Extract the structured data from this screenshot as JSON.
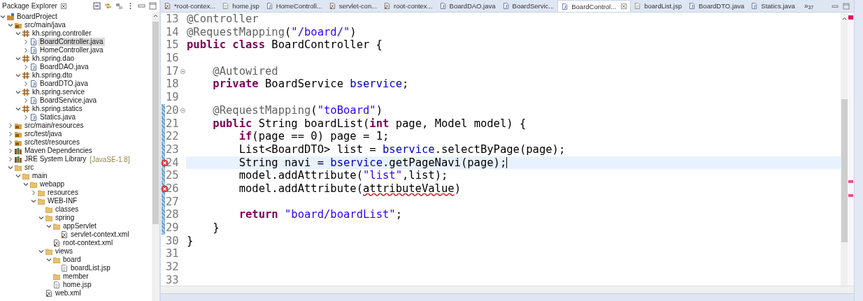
{
  "explorer": {
    "title": "Package Explorer",
    "tree": [
      {
        "label": "BoardProject",
        "kind": "project",
        "expanded": true,
        "selected": false,
        "children": [
          {
            "label": "src/main/java",
            "kind": "source-folder",
            "expanded": true,
            "selected": false,
            "children": [
              {
                "label": "kh.spring.controller",
                "kind": "package",
                "expanded": true,
                "selected": false,
                "children": [
                  {
                    "label": "BoardController.java",
                    "kind": "java",
                    "expanded": false,
                    "selected": true
                  },
                  {
                    "label": "HomeController.java",
                    "kind": "java",
                    "expanded": false,
                    "selected": false
                  }
                ]
              },
              {
                "label": "kh.spring.dao",
                "kind": "package",
                "expanded": true,
                "selected": false,
                "children": [
                  {
                    "label": "BoardDAO.java",
                    "kind": "java",
                    "expanded": false,
                    "selected": false
                  }
                ]
              },
              {
                "label": "kh.spring.dto",
                "kind": "package",
                "expanded": true,
                "selected": false,
                "children": [
                  {
                    "label": "BoardDTO.java",
                    "kind": "java",
                    "expanded": false,
                    "selected": false
                  }
                ]
              },
              {
                "label": "kh.spring.service",
                "kind": "package",
                "expanded": true,
                "selected": false,
                "children": [
                  {
                    "label": "BoardService.java",
                    "kind": "java",
                    "expanded": false,
                    "selected": false
                  }
                ]
              },
              {
                "label": "kh.spring.statics",
                "kind": "package",
                "expanded": true,
                "selected": false,
                "children": [
                  {
                    "label": "Statics.java",
                    "kind": "java",
                    "expanded": false,
                    "selected": false
                  }
                ]
              }
            ]
          },
          {
            "label": "src/main/resources",
            "kind": "source-folder",
            "expanded": false,
            "selected": false
          },
          {
            "label": "src/test/java",
            "kind": "source-folder",
            "expanded": false,
            "selected": false
          },
          {
            "label": "src/test/resources",
            "kind": "source-folder",
            "expanded": false,
            "selected": false
          },
          {
            "label": "Maven Dependencies",
            "kind": "library",
            "expanded": false,
            "selected": false
          },
          {
            "label": "JRE System Library",
            "decoration": "[JavaSE-1.8]",
            "kind": "library",
            "expanded": false,
            "selected": false
          },
          {
            "label": "src",
            "kind": "folder",
            "expanded": true,
            "selected": false,
            "children": [
              {
                "label": "main",
                "kind": "folder",
                "expanded": true,
                "selected": false,
                "children": [
                  {
                    "label": "webapp",
                    "kind": "folder",
                    "expanded": true,
                    "selected": false,
                    "children": [
                      {
                        "label": "resources",
                        "kind": "folder",
                        "expanded": false,
                        "selected": false
                      },
                      {
                        "label": "WEB-INF",
                        "kind": "folder",
                        "expanded": true,
                        "selected": false,
                        "children": [
                          {
                            "label": "classes",
                            "kind": "folder",
                            "selected": false
                          },
                          {
                            "label": "spring",
                            "kind": "folder",
                            "expanded": true,
                            "selected": false,
                            "children": [
                              {
                                "label": "appServlet",
                                "kind": "folder",
                                "expanded": true,
                                "selected": false,
                                "children": [
                                  {
                                    "label": "servlet-context.xml",
                                    "kind": "xml",
                                    "selected": false
                                  }
                                ]
                              },
                              {
                                "label": "root-context.xml",
                                "kind": "xml",
                                "selected": false
                              }
                            ]
                          },
                          {
                            "label": "views",
                            "kind": "folder",
                            "expanded": true,
                            "selected": false,
                            "children": [
                              {
                                "label": "board",
                                "kind": "folder",
                                "expanded": true,
                                "selected": false,
                                "children": [
                                  {
                                    "label": "boardList.jsp",
                                    "kind": "jsp",
                                    "selected": false
                                  }
                                ]
                              },
                              {
                                "label": "member",
                                "kind": "folder",
                                "selected": false
                              },
                              {
                                "label": "home.jsp",
                                "kind": "jsp",
                                "selected": false
                              }
                            ]
                          },
                          {
                            "label": "web.xml",
                            "kind": "xml",
                            "selected": false
                          }
                        ]
                      }
                    ]
                  }
                ]
              }
            ]
          }
        ]
      }
    ]
  },
  "editor": {
    "tabs": [
      {
        "label": "*root-contex...",
        "kind": "xml",
        "selected": false
      },
      {
        "label": "home.jsp",
        "kind": "jsp",
        "selected": false
      },
      {
        "label": "HomeControll...",
        "kind": "java",
        "selected": false
      },
      {
        "label": "servlet-con...",
        "kind": "xml",
        "selected": false
      },
      {
        "label": "root-contex...",
        "kind": "xml",
        "selected": false
      },
      {
        "label": "BoardDAO.java",
        "kind": "java",
        "selected": false
      },
      {
        "label": "BoardServic...",
        "kind": "java",
        "selected": false
      },
      {
        "label": "BoardControl...",
        "kind": "java",
        "selected": true
      },
      {
        "label": "boardList.jsp",
        "kind": "jsp",
        "selected": false
      },
      {
        "label": "BoardDTO.java",
        "kind": "java",
        "selected": false
      },
      {
        "label": "Statics.java",
        "kind": "java",
        "selected": false
      }
    ],
    "overflow": {
      "glyph": "»",
      "count": "37"
    },
    "lines": [
      {
        "number": "13",
        "segments": [
          {
            "text": "@Controller",
            "kind": "annotation"
          }
        ]
      },
      {
        "number": "14",
        "segments": [
          {
            "text": "@RequestMapping",
            "kind": "annotation"
          },
          {
            "text": "(",
            "kind": "plain"
          },
          {
            "text": "\"/board/\"",
            "kind": "string"
          },
          {
            "text": ")",
            "kind": "plain"
          }
        ]
      },
      {
        "number": "15",
        "segments": [
          {
            "text": "public class",
            "kind": "keyword"
          },
          {
            "text": " BoardController {",
            "kind": "plain"
          }
        ]
      },
      {
        "number": "16"
      },
      {
        "number": "17",
        "fold": true,
        "segments": [
          {
            "text": "    @Autowired",
            "kind": "annotation"
          }
        ]
      },
      {
        "number": "18",
        "segments": [
          {
            "text": "    private",
            "kind": "keyword"
          },
          {
            "text": " BoardService ",
            "kind": "plain"
          },
          {
            "text": "bservice",
            "kind": "field"
          },
          {
            "text": ";",
            "kind": "plain"
          }
        ]
      },
      {
        "number": "19"
      },
      {
        "number": "20",
        "fold": true,
        "changed": true,
        "segments": [
          {
            "text": "    @RequestMapping",
            "kind": "annotation"
          },
          {
            "text": "(",
            "kind": "plain"
          },
          {
            "text": "\"toBoard\"",
            "kind": "string"
          },
          {
            "text": ")",
            "kind": "plain"
          }
        ]
      },
      {
        "number": "21",
        "changed": true,
        "segments": [
          {
            "text": "    public",
            "kind": "keyword"
          },
          {
            "text": " String boardList(",
            "kind": "plain"
          },
          {
            "text": "int",
            "kind": "keyword"
          },
          {
            "text": " page, Model model) {",
            "kind": "plain"
          }
        ]
      },
      {
        "number": "22",
        "changed": true,
        "segments": [
          {
            "text": "        if",
            "kind": "keyword"
          },
          {
            "text": "(page == 0) page = 1;",
            "kind": "plain"
          }
        ]
      },
      {
        "number": "23",
        "changed": true,
        "segments": [
          {
            "text": "        List<BoardDTO> list = ",
            "kind": "plain"
          },
          {
            "text": "bservice",
            "kind": "field"
          },
          {
            "text": ".selectByPage(page);",
            "kind": "plain"
          }
        ]
      },
      {
        "number": "24",
        "changed": true,
        "error": true,
        "current": true,
        "segments": [
          {
            "text": "        String navi = ",
            "kind": "plain"
          },
          {
            "text": "bservice",
            "kind": "field"
          },
          {
            "text": ".getPageNavi(page);",
            "kind": "plain"
          }
        ]
      },
      {
        "number": "25",
        "changed": true,
        "segments": [
          {
            "text": "        model.addAttribute(",
            "kind": "plain"
          },
          {
            "text": "\"list\"",
            "kind": "string"
          },
          {
            "text": ",list);",
            "kind": "plain"
          }
        ]
      },
      {
        "number": "26",
        "changed": true,
        "error": true,
        "segments": [
          {
            "text": "        model.addAttribute(",
            "kind": "plain"
          },
          {
            "text": "attributeValue",
            "kind": "error"
          },
          {
            "text": ")",
            "kind": "plain"
          }
        ]
      },
      {
        "number": "27",
        "changed": true
      },
      {
        "number": "28",
        "changed": true,
        "segments": [
          {
            "text": "        return ",
            "kind": "keyword"
          },
          {
            "text": "\"board/boardList\"",
            "kind": "string"
          },
          {
            "text": ";",
            "kind": "plain"
          }
        ]
      },
      {
        "number": "29",
        "changed": true,
        "segments": [
          {
            "text": "    }",
            "kind": "plain"
          }
        ]
      },
      {
        "number": "30",
        "segments": [
          {
            "text": "}",
            "kind": "plain"
          }
        ]
      },
      {
        "number": "31"
      },
      {
        "number": "32"
      },
      {
        "number": "33"
      }
    ]
  }
}
